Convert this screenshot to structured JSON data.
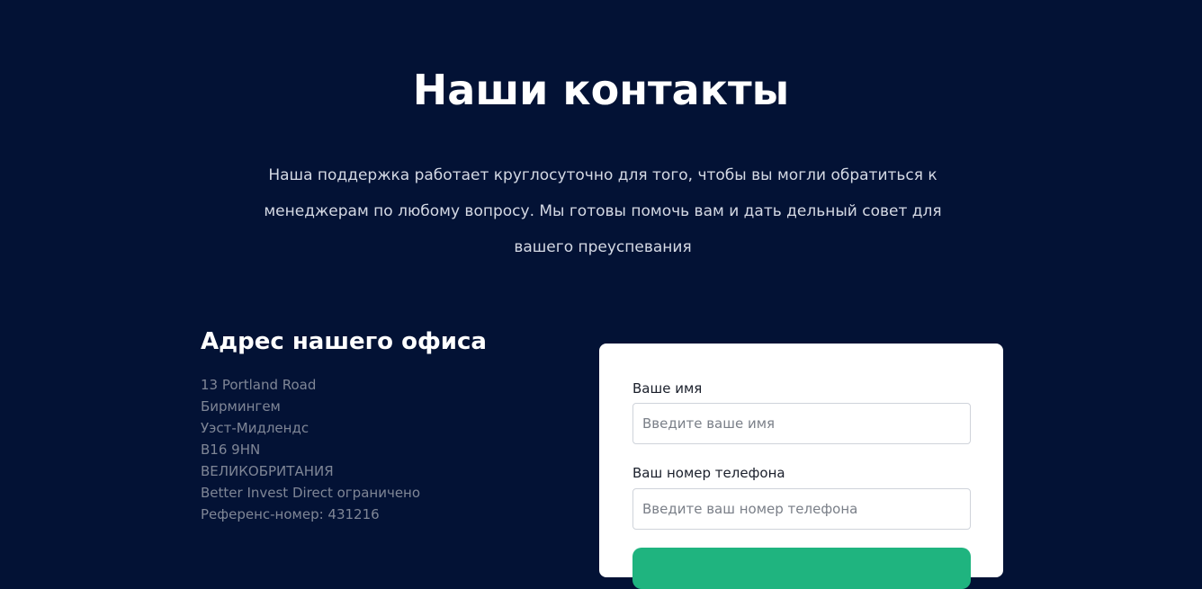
{
  "header": {
    "title": "Наши контакты",
    "intro_lines": [
      "Наша поддержка работает круглосуточно для того, чтобы вы могли обратиться к",
      "менеджерам по любому вопросу. Мы готовы помочь вам и дать дельный совет для",
      "вашего преуспевания"
    ]
  },
  "office": {
    "title": "Адрес нашего офиса",
    "address_lines": [
      "13 Portland Road",
      "Бирмингем",
      "Уэст-Мидлендс",
      "B16 9HN",
      "ВЕЛИКОБРИТАНИЯ",
      "Better Invest Direct ограничено",
      "Референс-номер: 431216"
    ]
  },
  "form": {
    "name_label": "Ваше имя",
    "name_placeholder": "Введите ваше имя",
    "phone_label": "Ваш номер телефона",
    "phone_placeholder": "Введите ваш номер телефона"
  },
  "colors": {
    "background": "#031235",
    "accent": "#1fb47f"
  }
}
